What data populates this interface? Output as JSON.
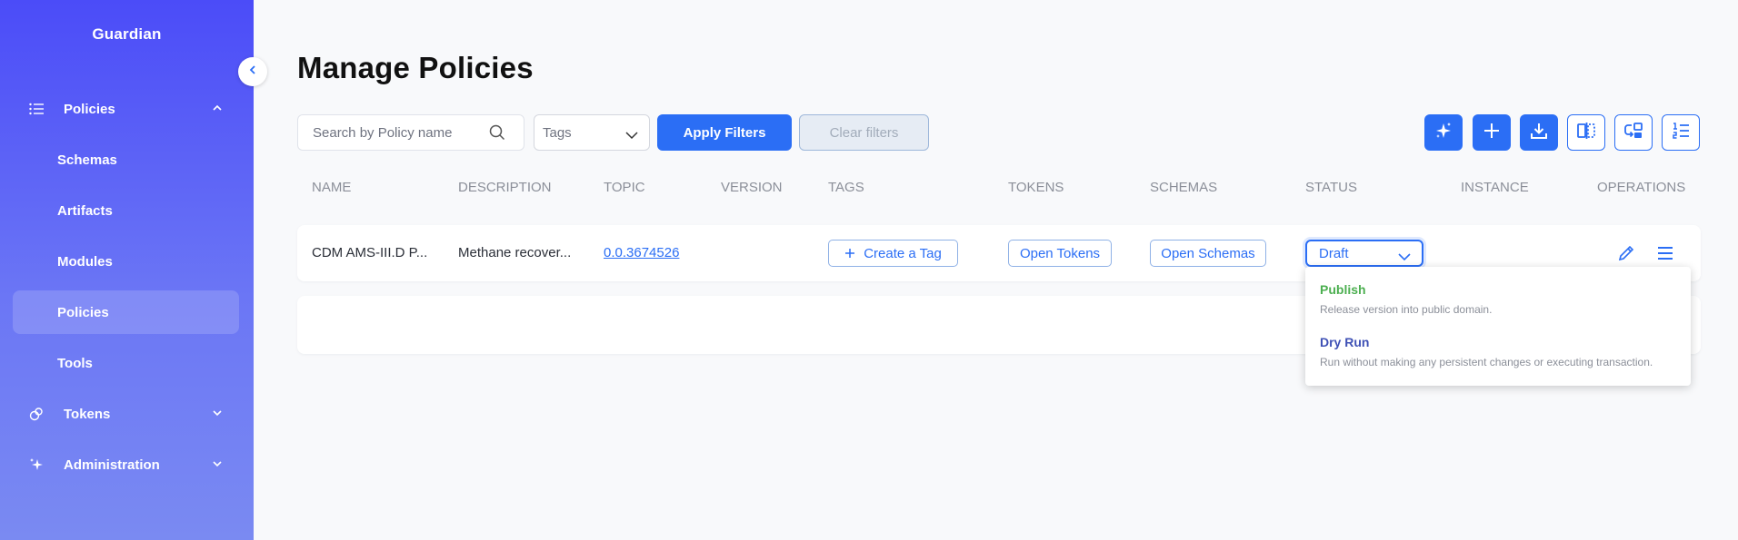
{
  "app": {
    "brand": "Guardian"
  },
  "sidebar": {
    "items": [
      {
        "label": "Policies",
        "icon": "list-icon",
        "expanded": true
      },
      {
        "label": "Schemas"
      },
      {
        "label": "Artifacts"
      },
      {
        "label": "Modules"
      },
      {
        "label": "Policies",
        "active": true
      },
      {
        "label": "Tools"
      },
      {
        "label": "Tokens",
        "icon": "tokens-icon",
        "expanded": false
      },
      {
        "label": "Administration",
        "icon": "sparkle-icon",
        "expanded": false
      }
    ]
  },
  "page": {
    "title": "Manage Policies"
  },
  "filters": {
    "search_placeholder": "Search by Policy name",
    "tags_placeholder": "Tags",
    "apply_label": "Apply Filters",
    "clear_label": "Clear filters"
  },
  "toolbar": {
    "buttons": [
      "ai-sparkle-icon",
      "plus-icon",
      "import-icon",
      "compare-icon",
      "migrate-icon",
      "suggestions-icon"
    ]
  },
  "table": {
    "headers": [
      "NAME",
      "DESCRIPTION",
      "TOPIC",
      "VERSION",
      "TAGS",
      "TOKENS",
      "SCHEMAS",
      "STATUS",
      "INSTANCE",
      "OPERATIONS"
    ],
    "rows": [
      {
        "name": "CDM AMS-III.D P...",
        "description": "Methane recover...",
        "topic": "0.0.3674526",
        "version": "",
        "tags_button": "Create a Tag",
        "tokens_button": "Open Tokens",
        "schemas_button": "Open Schemas",
        "status": "Draft",
        "instance": ""
      }
    ]
  },
  "status_menu": {
    "options": [
      {
        "title": "Publish",
        "description": "Release version into public domain.",
        "color": "#4caf50"
      },
      {
        "title": "Dry Run",
        "description": "Run without making any persistent changes or executing transaction.",
        "color": "#3f51b5"
      }
    ]
  },
  "colors": {
    "accent": "#2b6ef5",
    "sidebar_top": "#4b4cf8",
    "sidebar_bottom": "#7a8af2"
  }
}
